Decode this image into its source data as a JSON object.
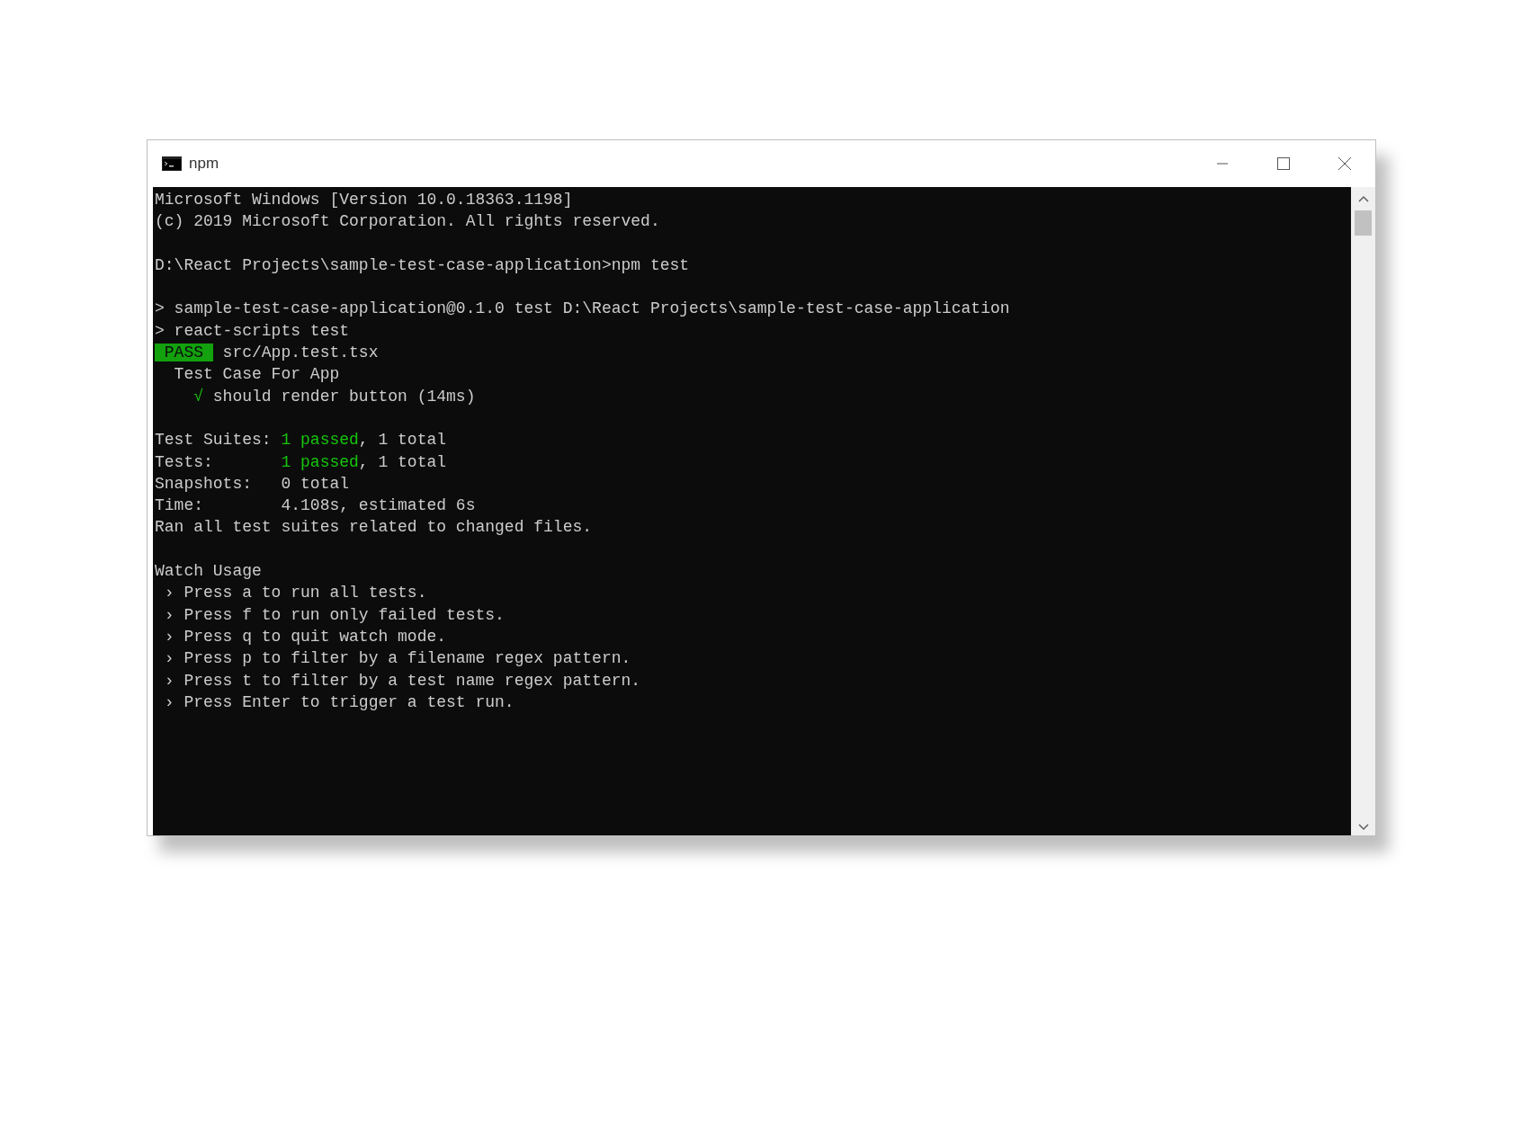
{
  "window": {
    "title": "npm"
  },
  "terminal": {
    "blocks": [
      {
        "lines": [
          {
            "segments": [
              {
                "kind": "text",
                "text": "Microsoft Windows [Version 10.0.18363.1198]"
              }
            ]
          },
          {
            "segments": [
              {
                "kind": "text",
                "text": "(c) 2019 Microsoft Corporation. All rights reserved."
              }
            ]
          }
        ]
      },
      {
        "lines": [
          {
            "segments": [
              {
                "kind": "text",
                "text": "D:\\React Projects\\sample-test-case-application>npm test"
              }
            ]
          }
        ]
      },
      {
        "lines": [
          {
            "segments": [
              {
                "kind": "text",
                "text": "> sample-test-case-application@0.1.0 test D:\\React Projects\\sample-test-case-application"
              }
            ]
          },
          {
            "segments": [
              {
                "kind": "text",
                "text": "> react-scripts test"
              }
            ]
          },
          {
            "segments": [
              {
                "kind": "badge",
                "text": " PASS "
              },
              {
                "kind": "text",
                "text": " src/App.test.tsx"
              }
            ]
          },
          {
            "segments": [
              {
                "kind": "text",
                "text": "  Test Case For App"
              }
            ],
            "children": [
              {
                "segments": [
                  {
                    "kind": "success",
                    "text": "√"
                  },
                  {
                    "kind": "text",
                    "text": " should render button (14ms)"
                  }
                ]
              }
            ]
          }
        ]
      },
      {
        "lines": [
          {
            "segments": [
              {
                "kind": "text",
                "text": "Test Suites: "
              },
              {
                "kind": "success",
                "text": "1 passed"
              },
              {
                "kind": "text",
                "text": ", 1 total"
              }
            ]
          },
          {
            "segments": [
              {
                "kind": "text",
                "text": "Tests:       "
              },
              {
                "kind": "success",
                "text": "1 passed"
              },
              {
                "kind": "text",
                "text": ", 1 total"
              }
            ]
          },
          {
            "segments": [
              {
                "kind": "text",
                "text": "Snapshots:   0 total"
              }
            ]
          },
          {
            "segments": [
              {
                "kind": "text",
                "text": "Time:        4.108s, estimated 6s"
              }
            ]
          },
          {
            "segments": [
              {
                "kind": "text",
                "text": "Ran all test suites related to changed files."
              }
            ]
          }
        ]
      },
      {
        "lines": [
          {
            "segments": [
              {
                "kind": "text",
                "text": "Watch Usage"
              }
            ]
          },
          {
            "segments": [
              {
                "kind": "text",
                "text": " › Press a to run all tests."
              }
            ]
          },
          {
            "segments": [
              {
                "kind": "text",
                "text": " › Press f to run only failed tests."
              }
            ]
          },
          {
            "segments": [
              {
                "kind": "text",
                "text": " › Press q to quit watch mode."
              }
            ]
          },
          {
            "segments": [
              {
                "kind": "text",
                "text": " › Press p to filter by a filename regex pattern."
              }
            ]
          },
          {
            "segments": [
              {
                "kind": "text",
                "text": " › Press t to filter by a test name regex pattern."
              }
            ]
          },
          {
            "segments": [
              {
                "kind": "text",
                "text": " › Press Enter to trigger a test run."
              }
            ]
          }
        ]
      }
    ]
  }
}
